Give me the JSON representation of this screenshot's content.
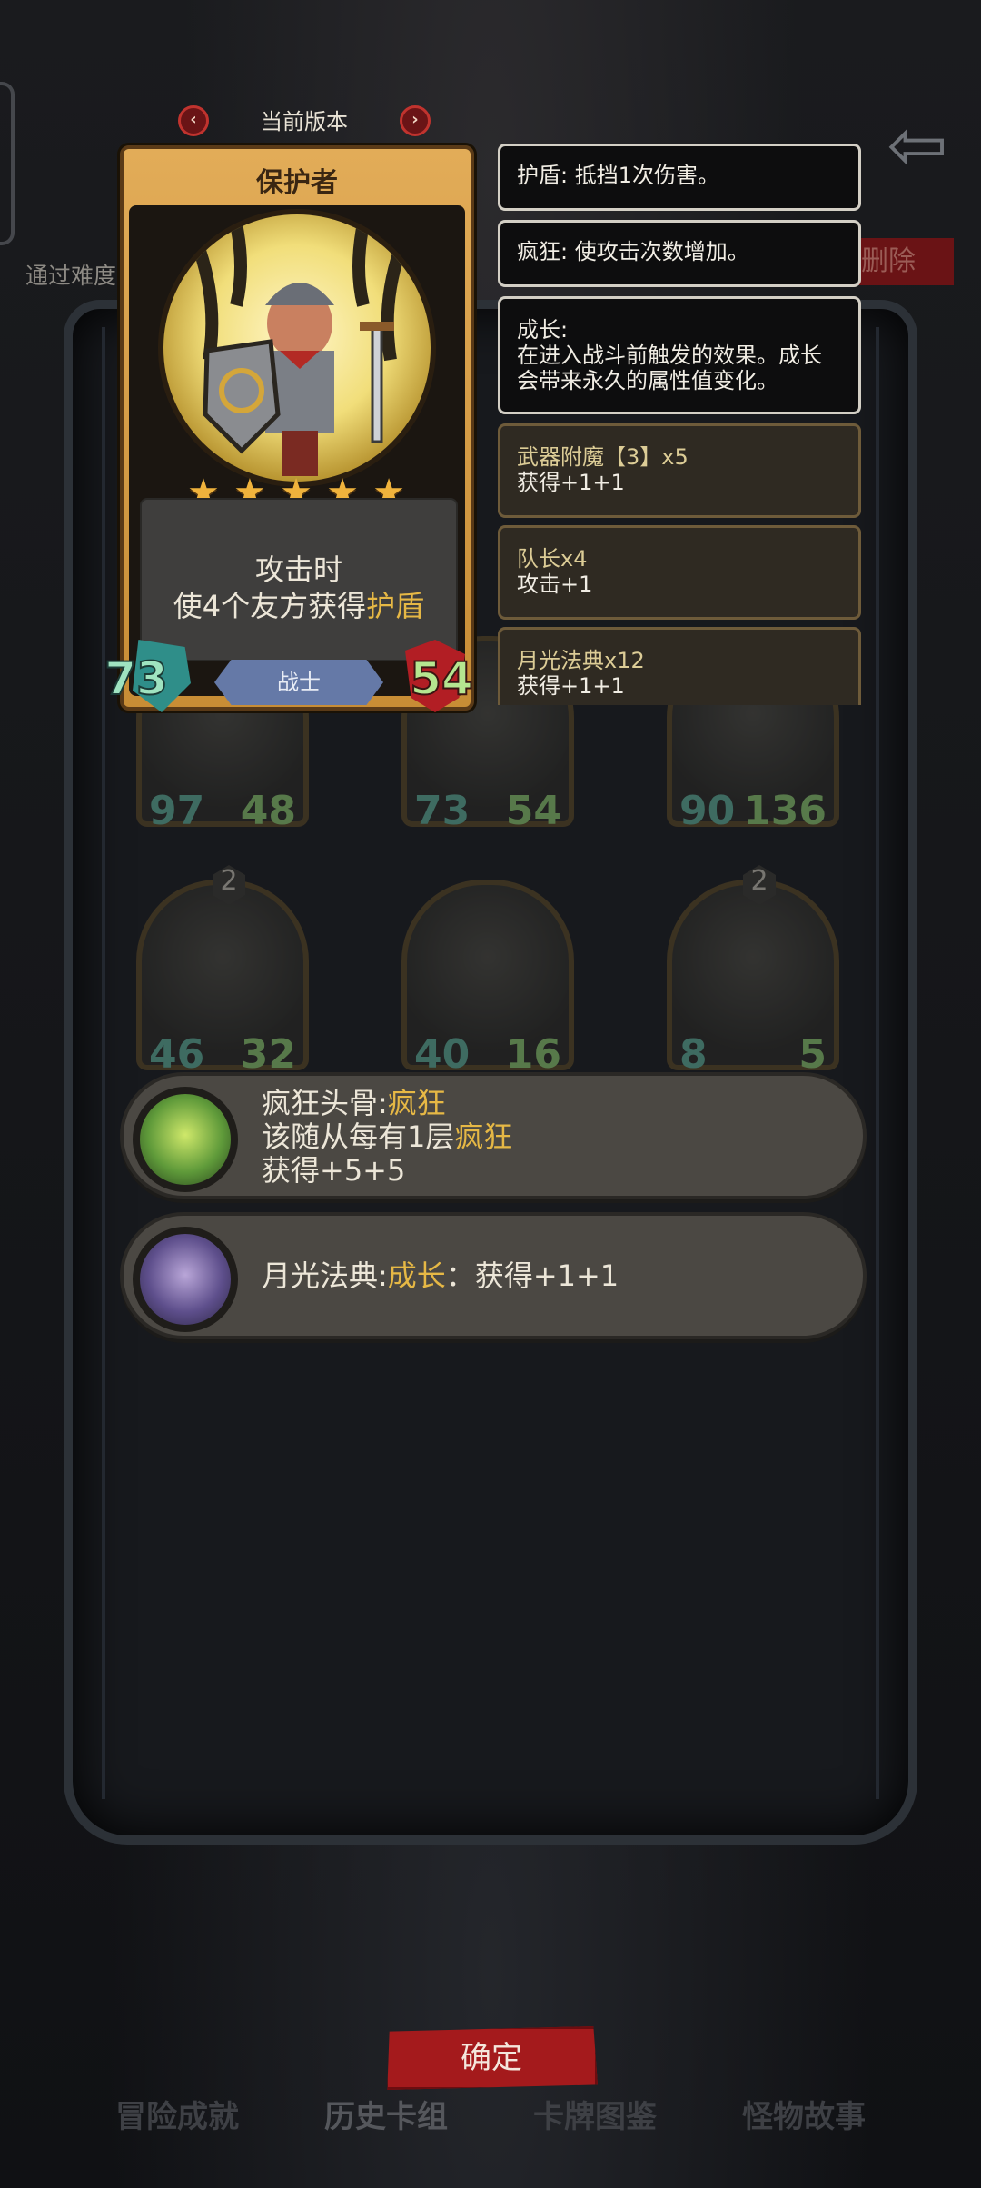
{
  "header": {
    "version_label": "当前版本",
    "prev_icon": "chevron-left-icon",
    "next_icon": "chevron-right-icon",
    "back_icon": "back-arrow-icon"
  },
  "background": {
    "difficulty_text": "通过难度",
    "delete_label": "删除"
  },
  "card": {
    "name": "保护者",
    "stars": 5,
    "description_line1": "攻击时",
    "description_line2_prefix": "使4个友方获得",
    "description_line2_keyword": "护盾",
    "attack": "73",
    "health": "54",
    "class": "战士"
  },
  "keywords": [
    {
      "text": "护盾: 抵挡1次伤害。"
    },
    {
      "text": "疯狂: 使攻击次数增加。"
    },
    {
      "text": "成长:\n在进入战斗前触发的效果。成长会带来永久的属性值变化。"
    }
  ],
  "buffs": [
    {
      "name": "武器附魔【3】x5",
      "effect": "获得+1+1"
    },
    {
      "name": "队长x4",
      "effect": "攻击+1"
    },
    {
      "name": "月光法典x12",
      "effect": "获得+1+1"
    }
  ],
  "minions": [
    {
      "atk": "97",
      "hp": "48",
      "level": ""
    },
    {
      "atk": "73",
      "hp": "54",
      "level": ""
    },
    {
      "atk": "90",
      "hp": "136",
      "level": ""
    },
    {
      "atk": "46",
      "hp": "32",
      "level": "2"
    },
    {
      "atk": "40",
      "hp": "16",
      "level": ""
    },
    {
      "atk": "8",
      "hp": "5",
      "level": "2"
    }
  ],
  "relics": [
    {
      "icon": "mad-skull-icon",
      "line1_prefix": "疯狂头骨:",
      "line1_keyword": "疯狂",
      "line2_prefix": "该随从每有1层",
      "line2_keyword": "疯狂",
      "line3": "获得+5+5"
    },
    {
      "icon": "moonlight-tome-icon",
      "line1_prefix": "月光法典:",
      "line1_keyword": "成长",
      "line1_suffix": "：获得+1+1"
    }
  ],
  "confirm_label": "确定",
  "tabs": [
    {
      "label": "冒险成就"
    },
    {
      "label": "历史卡组"
    },
    {
      "label": "卡牌图鉴"
    },
    {
      "label": "怪物故事"
    }
  ],
  "colors": {
    "keyword_highlight": "#e6b845",
    "card_gold": "#e2ac58",
    "confirm_red": "#a41a1c",
    "class_banner": "#6579a7"
  }
}
